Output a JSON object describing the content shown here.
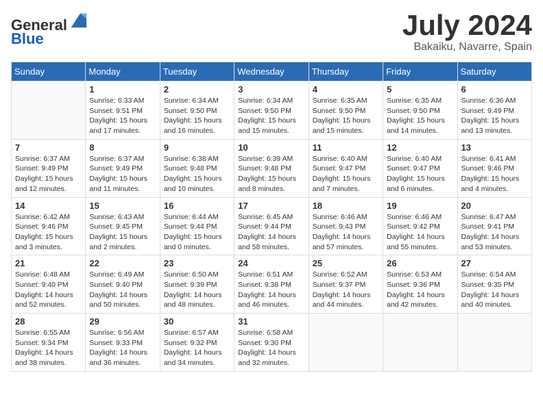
{
  "header": {
    "logo_general": "General",
    "logo_blue": "Blue",
    "month_title": "July 2024",
    "location": "Bakaiku, Navarre, Spain"
  },
  "weekdays": [
    "Sunday",
    "Monday",
    "Tuesday",
    "Wednesday",
    "Thursday",
    "Friday",
    "Saturday"
  ],
  "weeks": [
    [
      {
        "day": "",
        "info": ""
      },
      {
        "day": "1",
        "info": "Sunrise: 6:33 AM\nSunset: 9:51 PM\nDaylight: 15 hours\nand 17 minutes."
      },
      {
        "day": "2",
        "info": "Sunrise: 6:34 AM\nSunset: 9:50 PM\nDaylight: 15 hours\nand 16 minutes."
      },
      {
        "day": "3",
        "info": "Sunrise: 6:34 AM\nSunset: 9:50 PM\nDaylight: 15 hours\nand 15 minutes."
      },
      {
        "day": "4",
        "info": "Sunrise: 6:35 AM\nSunset: 9:50 PM\nDaylight: 15 hours\nand 15 minutes."
      },
      {
        "day": "5",
        "info": "Sunrise: 6:35 AM\nSunset: 9:50 PM\nDaylight: 15 hours\nand 14 minutes."
      },
      {
        "day": "6",
        "info": "Sunrise: 6:36 AM\nSunset: 9:49 PM\nDaylight: 15 hours\nand 13 minutes."
      }
    ],
    [
      {
        "day": "7",
        "info": "Sunrise: 6:37 AM\nSunset: 9:49 PM\nDaylight: 15 hours\nand 12 minutes."
      },
      {
        "day": "8",
        "info": "Sunrise: 6:37 AM\nSunset: 9:49 PM\nDaylight: 15 hours\nand 11 minutes."
      },
      {
        "day": "9",
        "info": "Sunrise: 6:38 AM\nSunset: 9:48 PM\nDaylight: 15 hours\nand 10 minutes."
      },
      {
        "day": "10",
        "info": "Sunrise: 6:39 AM\nSunset: 9:48 PM\nDaylight: 15 hours\nand 8 minutes."
      },
      {
        "day": "11",
        "info": "Sunrise: 6:40 AM\nSunset: 9:47 PM\nDaylight: 15 hours\nand 7 minutes."
      },
      {
        "day": "12",
        "info": "Sunrise: 6:40 AM\nSunset: 9:47 PM\nDaylight: 15 hours\nand 6 minutes."
      },
      {
        "day": "13",
        "info": "Sunrise: 6:41 AM\nSunset: 9:46 PM\nDaylight: 15 hours\nand 4 minutes."
      }
    ],
    [
      {
        "day": "14",
        "info": "Sunrise: 6:42 AM\nSunset: 9:46 PM\nDaylight: 15 hours\nand 3 minutes."
      },
      {
        "day": "15",
        "info": "Sunrise: 6:43 AM\nSunset: 9:45 PM\nDaylight: 15 hours\nand 2 minutes."
      },
      {
        "day": "16",
        "info": "Sunrise: 6:44 AM\nSunset: 9:44 PM\nDaylight: 15 hours\nand 0 minutes."
      },
      {
        "day": "17",
        "info": "Sunrise: 6:45 AM\nSunset: 9:44 PM\nDaylight: 14 hours\nand 58 minutes."
      },
      {
        "day": "18",
        "info": "Sunrise: 6:46 AM\nSunset: 9:43 PM\nDaylight: 14 hours\nand 57 minutes."
      },
      {
        "day": "19",
        "info": "Sunrise: 6:46 AM\nSunset: 9:42 PM\nDaylight: 14 hours\nand 55 minutes."
      },
      {
        "day": "20",
        "info": "Sunrise: 6:47 AM\nSunset: 9:41 PM\nDaylight: 14 hours\nand 53 minutes."
      }
    ],
    [
      {
        "day": "21",
        "info": "Sunrise: 6:48 AM\nSunset: 9:40 PM\nDaylight: 14 hours\nand 52 minutes."
      },
      {
        "day": "22",
        "info": "Sunrise: 6:49 AM\nSunset: 9:40 PM\nDaylight: 14 hours\nand 50 minutes."
      },
      {
        "day": "23",
        "info": "Sunrise: 6:50 AM\nSunset: 9:39 PM\nDaylight: 14 hours\nand 48 minutes."
      },
      {
        "day": "24",
        "info": "Sunrise: 6:51 AM\nSunset: 9:38 PM\nDaylight: 14 hours\nand 46 minutes."
      },
      {
        "day": "25",
        "info": "Sunrise: 6:52 AM\nSunset: 9:37 PM\nDaylight: 14 hours\nand 44 minutes."
      },
      {
        "day": "26",
        "info": "Sunrise: 6:53 AM\nSunset: 9:36 PM\nDaylight: 14 hours\nand 42 minutes."
      },
      {
        "day": "27",
        "info": "Sunrise: 6:54 AM\nSunset: 9:35 PM\nDaylight: 14 hours\nand 40 minutes."
      }
    ],
    [
      {
        "day": "28",
        "info": "Sunrise: 6:55 AM\nSunset: 9:34 PM\nDaylight: 14 hours\nand 38 minutes."
      },
      {
        "day": "29",
        "info": "Sunrise: 6:56 AM\nSunset: 9:33 PM\nDaylight: 14 hours\nand 36 minutes."
      },
      {
        "day": "30",
        "info": "Sunrise: 6:57 AM\nSunset: 9:32 PM\nDaylight: 14 hours\nand 34 minutes."
      },
      {
        "day": "31",
        "info": "Sunrise: 6:58 AM\nSunset: 9:30 PM\nDaylight: 14 hours\nand 32 minutes."
      },
      {
        "day": "",
        "info": ""
      },
      {
        "day": "",
        "info": ""
      },
      {
        "day": "",
        "info": ""
      }
    ]
  ]
}
